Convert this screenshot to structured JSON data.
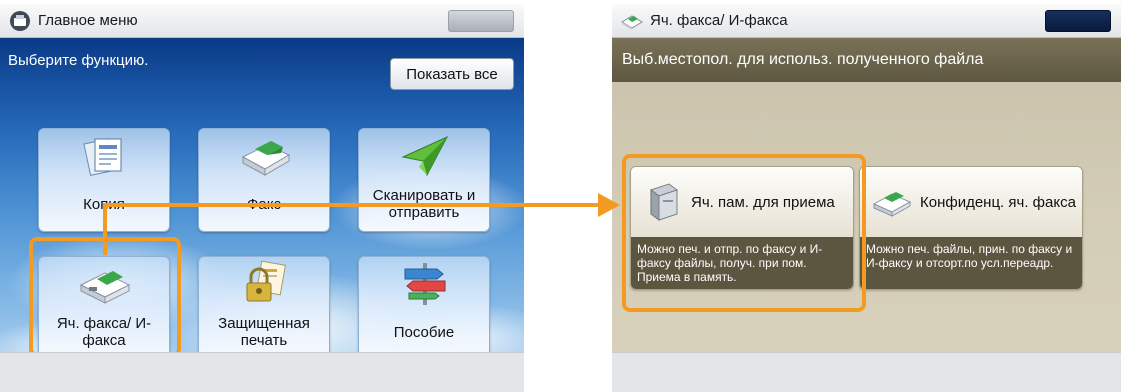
{
  "left_screen": {
    "title": "Главное меню",
    "prompt": "Выберите функцию.",
    "show_all_label": "Показать все",
    "tiles": [
      {
        "label": "Копия",
        "icon": "copy-icon"
      },
      {
        "label": "Факс",
        "icon": "fax-icon"
      },
      {
        "label": "Сканировать и отправить",
        "icon": "paper-plane-icon"
      },
      {
        "label": "Яч. факса/ И-факса",
        "icon": "fax-inbox-icon"
      },
      {
        "label": "Защищенная печать",
        "icon": "padlock-document-icon"
      },
      {
        "label": "Пособие",
        "icon": "signpost-icon"
      }
    ]
  },
  "right_screen": {
    "title": "Яч. факса/ И-факса",
    "header": "Выб.местопол. для использ. полученного файла",
    "tiles": [
      {
        "label": "Яч. пам. для приема",
        "description": "Можно печ. и отпр. по факсу и И-факсу файлы, получ. при пом. Приема в память.",
        "icon": "memory-inbox-icon"
      },
      {
        "label": "Конфиденц. яч. факса",
        "description": "Можно печ. файлы, прин. по факсу и И-факсу и отсорт.по усл.переадр.",
        "icon": "confidential-fax-icon"
      }
    ]
  },
  "colors": {
    "highlight": "#f29a22",
    "sky_top": "#0a3a86",
    "right_header": "#6b6550"
  }
}
